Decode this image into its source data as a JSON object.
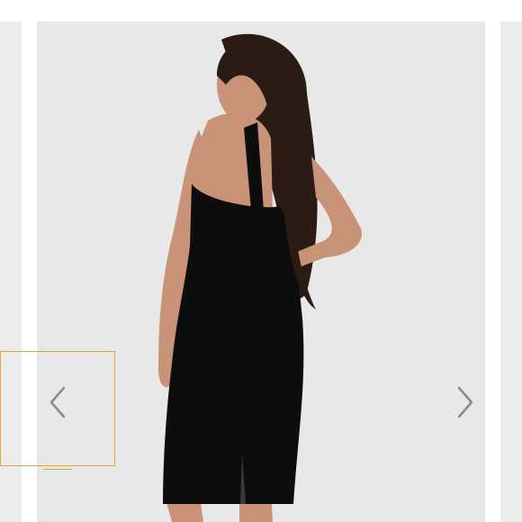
{
  "carousel": {
    "image": {
      "alt": ""
    },
    "prev_icon": "chevron-left-icon",
    "next_icon": "chevron-right-icon",
    "colors": {
      "slide_bg": "#e8e8e8",
      "side_bg": "#ebebeb",
      "chevron": "#8a8a8a",
      "focus_outline": "#e3a538",
      "dress": "#0d0d0d",
      "skin": "#c99377",
      "hair": "#2a1b14"
    }
  }
}
